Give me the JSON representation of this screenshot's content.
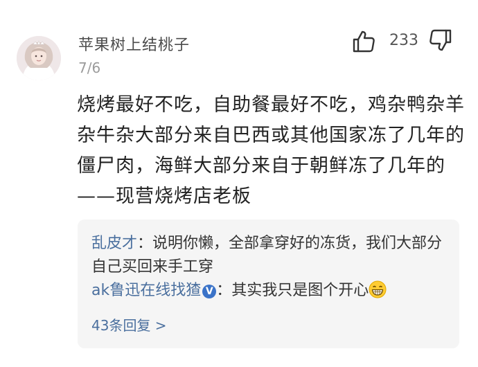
{
  "comment": {
    "username": "苹果树上结桃子",
    "date": "7/6",
    "like_count": "233",
    "text": "烧烤最好不吃，自助餐最好不吃，鸡杂鸭杂羊杂牛杂大部分来自巴西或其他国家冻了几年的僵尸肉，海鲜大部分来自于朝鲜冻了几年的——现营烧烤店老板"
  },
  "replies": [
    {
      "author": "乱皮才",
      "separator": "：",
      "text": "说明你懒，全部拿穿好的冻货，我们大部分自己买回来手工穿"
    },
    {
      "author": "ak鲁迅在线找猹",
      "badge": "V",
      "separator": "：",
      "text": "其实我只是图个开心"
    }
  ],
  "more_replies": "43条回复 >",
  "colors": {
    "link": "#4a6f9e",
    "reply_bg": "#f5f5f5",
    "badge": "#3b73c8"
  },
  "icons": {
    "like": "thumbs-up-icon",
    "dislike": "thumbs-down-icon",
    "emoji": "grinning-face-icon"
  }
}
